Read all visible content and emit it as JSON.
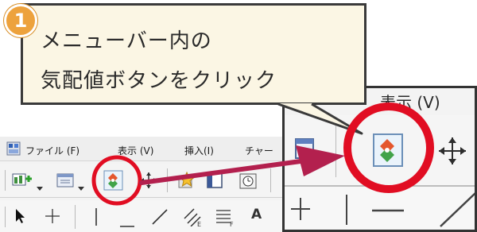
{
  "callout": {
    "step_number": "1",
    "line1": "メニューバー内の",
    "line2": "気配値ボタンをクリック"
  },
  "menubar": {
    "items": [
      {
        "label": "ファイル (F)"
      },
      {
        "label": "表示 (V)"
      },
      {
        "label": "挿入(I)"
      },
      {
        "label": "チャー"
      }
    ]
  },
  "zoom_menu": {
    "label": "表示 (V)"
  },
  "toolbar_icons": [
    "new-chart-icon",
    "window-icon",
    "market-depth-icon",
    "crosshair-move-icon",
    "favorites-star-icon",
    "navigator-icon",
    "timer-icon",
    "cursor-arrow-icon",
    "crosshair-icon",
    "vertical-line-icon",
    "horizontal-line-icon",
    "trend-line-icon",
    "equidistant-channel-icon",
    "fibonacci-icon",
    "text-icon"
  ],
  "text_tool_label": "A",
  "colors": {
    "highlight_red": "#e10d22",
    "arrow_crimson": "#b3204e",
    "callout_fill": "#fbf6e4",
    "badge_orange": "#eda23d"
  }
}
